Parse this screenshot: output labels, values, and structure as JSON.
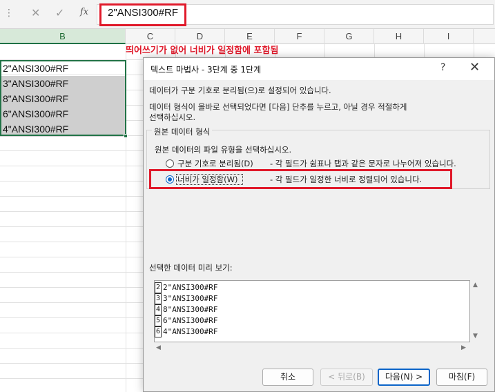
{
  "formula_bar": {
    "dots": "⋮",
    "cancel_glyph": "✕",
    "enter_glyph": "✓",
    "fx_label": "fx",
    "value": "2\"ANSI300#RF"
  },
  "columns": [
    "B",
    "C",
    "D",
    "E",
    "F",
    "G",
    "H",
    "I"
  ],
  "annotation": "띄어쓰기가 없어 너비가 일정함에 포함됨",
  "cells": [
    "2\"ANSI300#RF",
    "3\"ANSI300#RF",
    "8\"ANSI300#RF",
    "6\"ANSI300#RF",
    "4\"ANSI300#RF"
  ],
  "dialog": {
    "title": "텍스트 마법사 - 3단계 중 1단계",
    "help": "?",
    "close": "✕",
    "intro_line1": "데이터가 구분 기호로 분리됨(으)로 설정되어 있습니다.",
    "intro_line2": "데이터 형식이 올바로 선택되었다면 [다음] 단추를 누르고, 아닐 경우 적절하게",
    "intro_line3": "선택하십시오.",
    "group_title": "원본 데이터 형식",
    "group_prompt": "원본 데이터의 파일 유형을 선택하십시오.",
    "options": [
      {
        "label": "구분 기호로 분리됨(D)",
        "desc": "- 각 필드가 쉼표나 탭과 같은 문자로 나누어져 있습니다.",
        "selected": false
      },
      {
        "label": "너비가 일정함(W)",
        "desc": "- 각 필드가 일정한 너비로 정렬되어 있습니다.",
        "selected": true
      }
    ],
    "preview_label": "선택한 데이터 미리 보기:",
    "preview_rows": [
      {
        "num": "2",
        "text": "2\"ANSI300#RF"
      },
      {
        "num": "3",
        "text": "3\"ANSI300#RF"
      },
      {
        "num": "4",
        "text": "8\"ANSI300#RF"
      },
      {
        "num": "5",
        "text": "6\"ANSI300#RF"
      },
      {
        "num": "6",
        "text": "4\"ANSI300#RF"
      }
    ],
    "buttons": {
      "cancel": "취소",
      "back": "< 뒤로(B)",
      "next": "다음(N) >",
      "finish": "마침(F)"
    }
  },
  "colors": {
    "highlight_red": "#e0192a",
    "excel_green": "#217346",
    "radio_blue": "#0a64c8"
  }
}
